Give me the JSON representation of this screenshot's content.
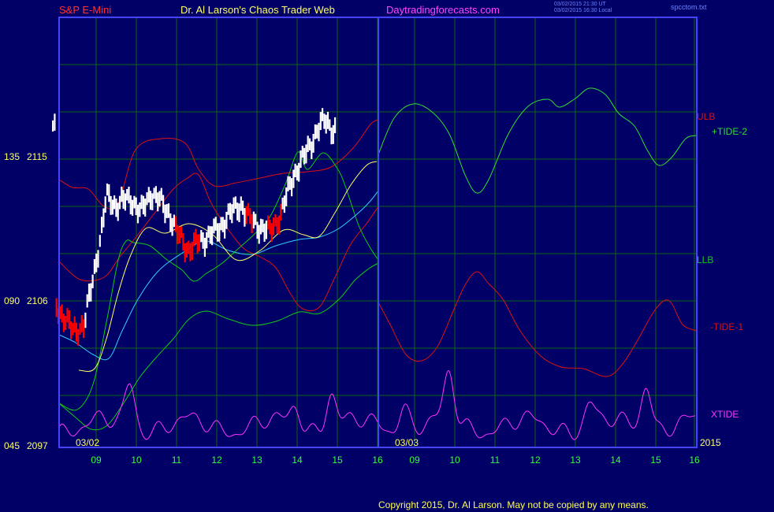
{
  "header": {
    "symbol": "S&P E-Mini",
    "title": "Dr. Al Larson's Chaos Trader Web",
    "site": "Daytradingforecasts.com",
    "timestamp_ut": "03/02/2015 21:30 UT",
    "timestamp_local": "03/02/2015 16:30 Local",
    "file": "spcctom.txt"
  },
  "footer": {
    "copyright": "Copyright 2015, Dr. Al Larson. May not be copied by any means."
  },
  "colors": {
    "background": "#000066",
    "frame": "#4444ff",
    "grid": "#106410",
    "price_up": "#ffffff",
    "price_down": "#ff0000",
    "ulb": "#dd1111",
    "llb": "#11cc11",
    "tide_plus": "#33dd33",
    "tide_minus": "#dd1111",
    "xtide": "#ff33ff",
    "ma_fast": "#ffff66",
    "ma_slow": "#33ccff",
    "axis_hours": "#33ff33",
    "axis_prices": "#ffff66"
  },
  "chart_data": {
    "type": "line",
    "title": "S&P E-Mini",
    "y_axis_labels": [
      {
        "osc": "135",
        "price": "2115"
      },
      {
        "osc": "090",
        "price": "2106"
      },
      {
        "osc": "045",
        "price": "2097"
      }
    ],
    "ylim": [
      2094.5,
      2121.7
    ],
    "x_hour_labels": [
      "09",
      "10",
      "11",
      "12",
      "13",
      "14",
      "15",
      "16",
      "09",
      "10",
      "11",
      "12",
      "13",
      "14",
      "15",
      "16"
    ],
    "date_labels": [
      "03/02",
      "03/03"
    ],
    "year_label": "2015",
    "grid": true,
    "series": [
      {
        "name": "ULB",
        "label": "ULB",
        "kind": "band"
      },
      {
        "name": "LLB",
        "label": "LLB",
        "kind": "band"
      },
      {
        "name": "+TIDE-2",
        "label": "+TIDE-2",
        "kind": "forecast"
      },
      {
        "name": "-TIDE-1",
        "label": "-TIDE-1",
        "kind": "forecast"
      },
      {
        "name": "XTIDE",
        "label": "XTIDE",
        "kind": "forecast"
      }
    ],
    "price_summary": {
      "day": "03/02",
      "session_low": 2102.3,
      "session_high": 2115.2,
      "last": 2114.6
    }
  }
}
